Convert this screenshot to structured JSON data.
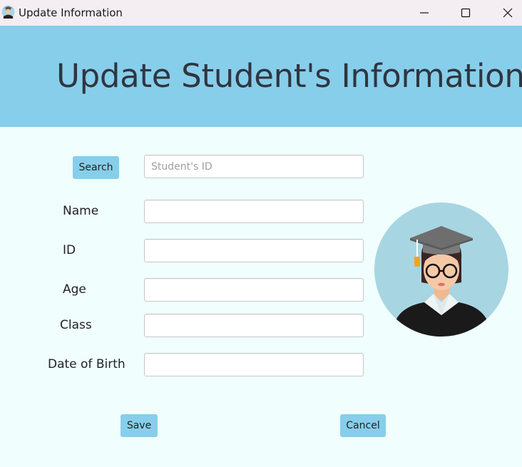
{
  "window": {
    "title": "Update Information",
    "icon": "student-avatar-icon",
    "controls": [
      "minimize-icon",
      "maximize-icon",
      "close-icon"
    ]
  },
  "banner": {
    "title": "Update Student's Information",
    "background": "#87ceeb",
    "text_color": "#2f3640"
  },
  "search": {
    "button_label": "Search",
    "placeholder": "Student's ID",
    "value": ""
  },
  "form": {
    "name_label": "Name",
    "name_value": "",
    "id_label": "ID",
    "id_value": "",
    "age_label": "Age",
    "age_value": "",
    "class_label": "Class",
    "class_value": "",
    "dob_label": "Date of Birth",
    "dob_value": ""
  },
  "actions": {
    "save_label": "Save",
    "cancel_label": "Cancel"
  },
  "colors": {
    "page_background": "#f0fefe",
    "accent": "#87ceeb"
  }
}
